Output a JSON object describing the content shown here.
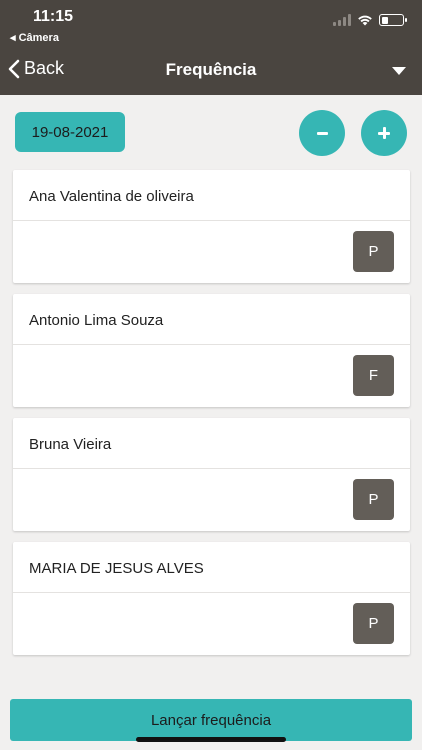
{
  "status_bar": {
    "time": "11:15",
    "back_app": "◂ Câmera",
    "icons": [
      "signal-icon",
      "wifi-icon",
      "battery-icon"
    ]
  },
  "nav": {
    "back_label": "Back",
    "title": "Frequência",
    "menu_icon": "dropdown-triangle-icon"
  },
  "controls": {
    "date": "19-08-2021",
    "minus_icon": "minus-icon",
    "plus_icon": "plus-icon"
  },
  "students": [
    {
      "name": "Ana Valentina de oliveira",
      "status": "P"
    },
    {
      "name": "Antonio Lima Souza",
      "status": "F"
    },
    {
      "name": "Bruna Vieira",
      "status": "P"
    },
    {
      "name": "MARIA DE JESUS ALVES",
      "status": "P"
    }
  ],
  "footer": {
    "submit_label": "Lançar frequência"
  },
  "colors": {
    "header": "#4a4540",
    "accent": "#36b6b4",
    "status_button": "#635e58",
    "background": "#f1f0ef"
  }
}
